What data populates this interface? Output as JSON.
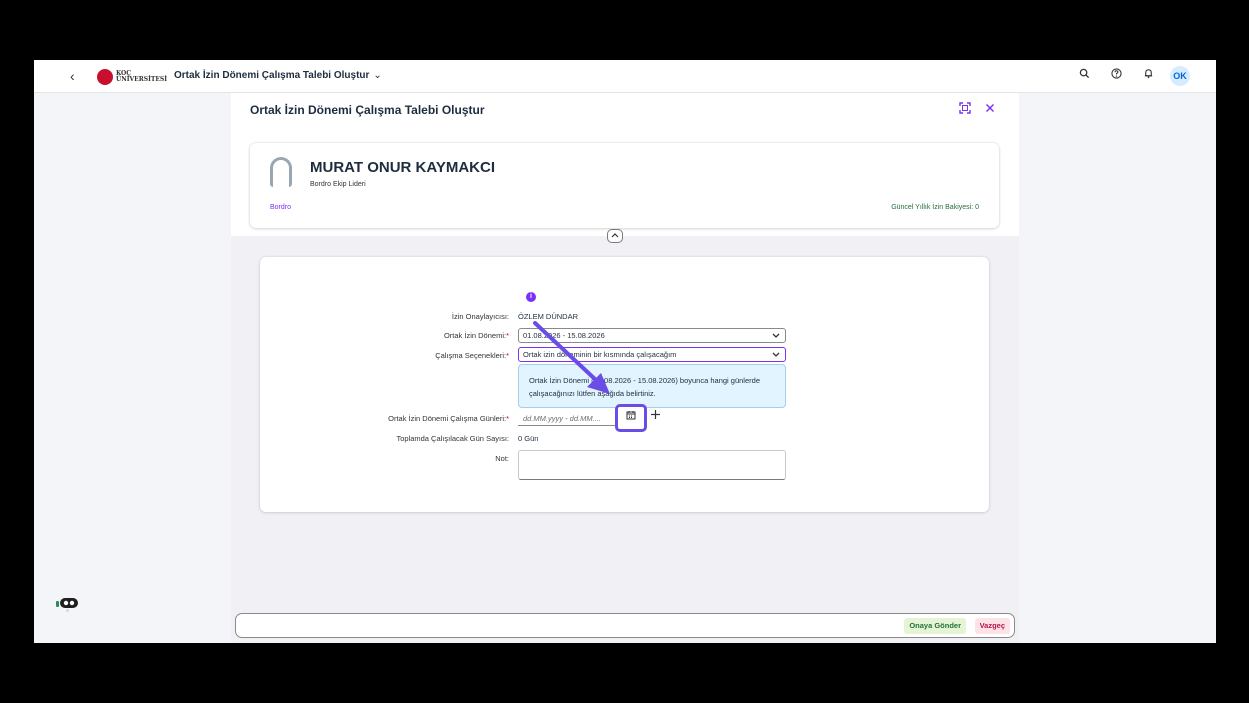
{
  "shell": {
    "back": "‹",
    "logo_line1": "KOÇ",
    "logo_line2": "ÜNİVERSİTESİ",
    "title": "Ortak İzin Dönemi Çalışma Talebi Oluştur",
    "title_chevron": "⌄",
    "avatar_initials": "OK",
    "icons": [
      "search-icon",
      "help-icon",
      "bell-icon"
    ]
  },
  "page": {
    "title": "Ortak İzin Dönemi Çalışma Talebi Oluştur"
  },
  "profile": {
    "name": "MURAT ONUR KAYMAKCI",
    "role": "Bordro Ekip Lideri",
    "department": "Bordro",
    "balance": "Güncel Yıllık İzin Bakiyesi: 0"
  },
  "form": {
    "approver_label": "İzin Onaylayıcısı:",
    "approver_value": "ÖZLEM DÜNDAR",
    "period_label": "Ortak İzin Dönemi:",
    "period_value": "01.08.2026 - 15.08.2026",
    "options_label": "Çalışma Seçenekleri:",
    "options_value": "Ortak izin döneminin bir kısmında çalışacağım",
    "info_text": "Ortak İzin Dönemi (01.08.2026 - 15.08.2026) boyunca hangi günlerde çalışacağınızı lütfen aşağıda belirtiniz.",
    "days_label": "Ortak İzin Dönemi Çalışma Günleri:",
    "days_placeholder": "dd.MM.yyyy - dd.MM....",
    "total_label": "Toplamda Çalışılacak Gün Sayısı:",
    "total_value": "0 Gün",
    "note_label": "Not:",
    "required_mark": "*"
  },
  "footer": {
    "submit": "Onaya Gönder",
    "cancel": "Vazgeç"
  },
  "colors": {
    "accent": "#7b2ff7",
    "highlight": "#6a4ce6",
    "info_bg": "#e1f4ff",
    "positive": "#256f3a",
    "negative": "#b4154a"
  }
}
